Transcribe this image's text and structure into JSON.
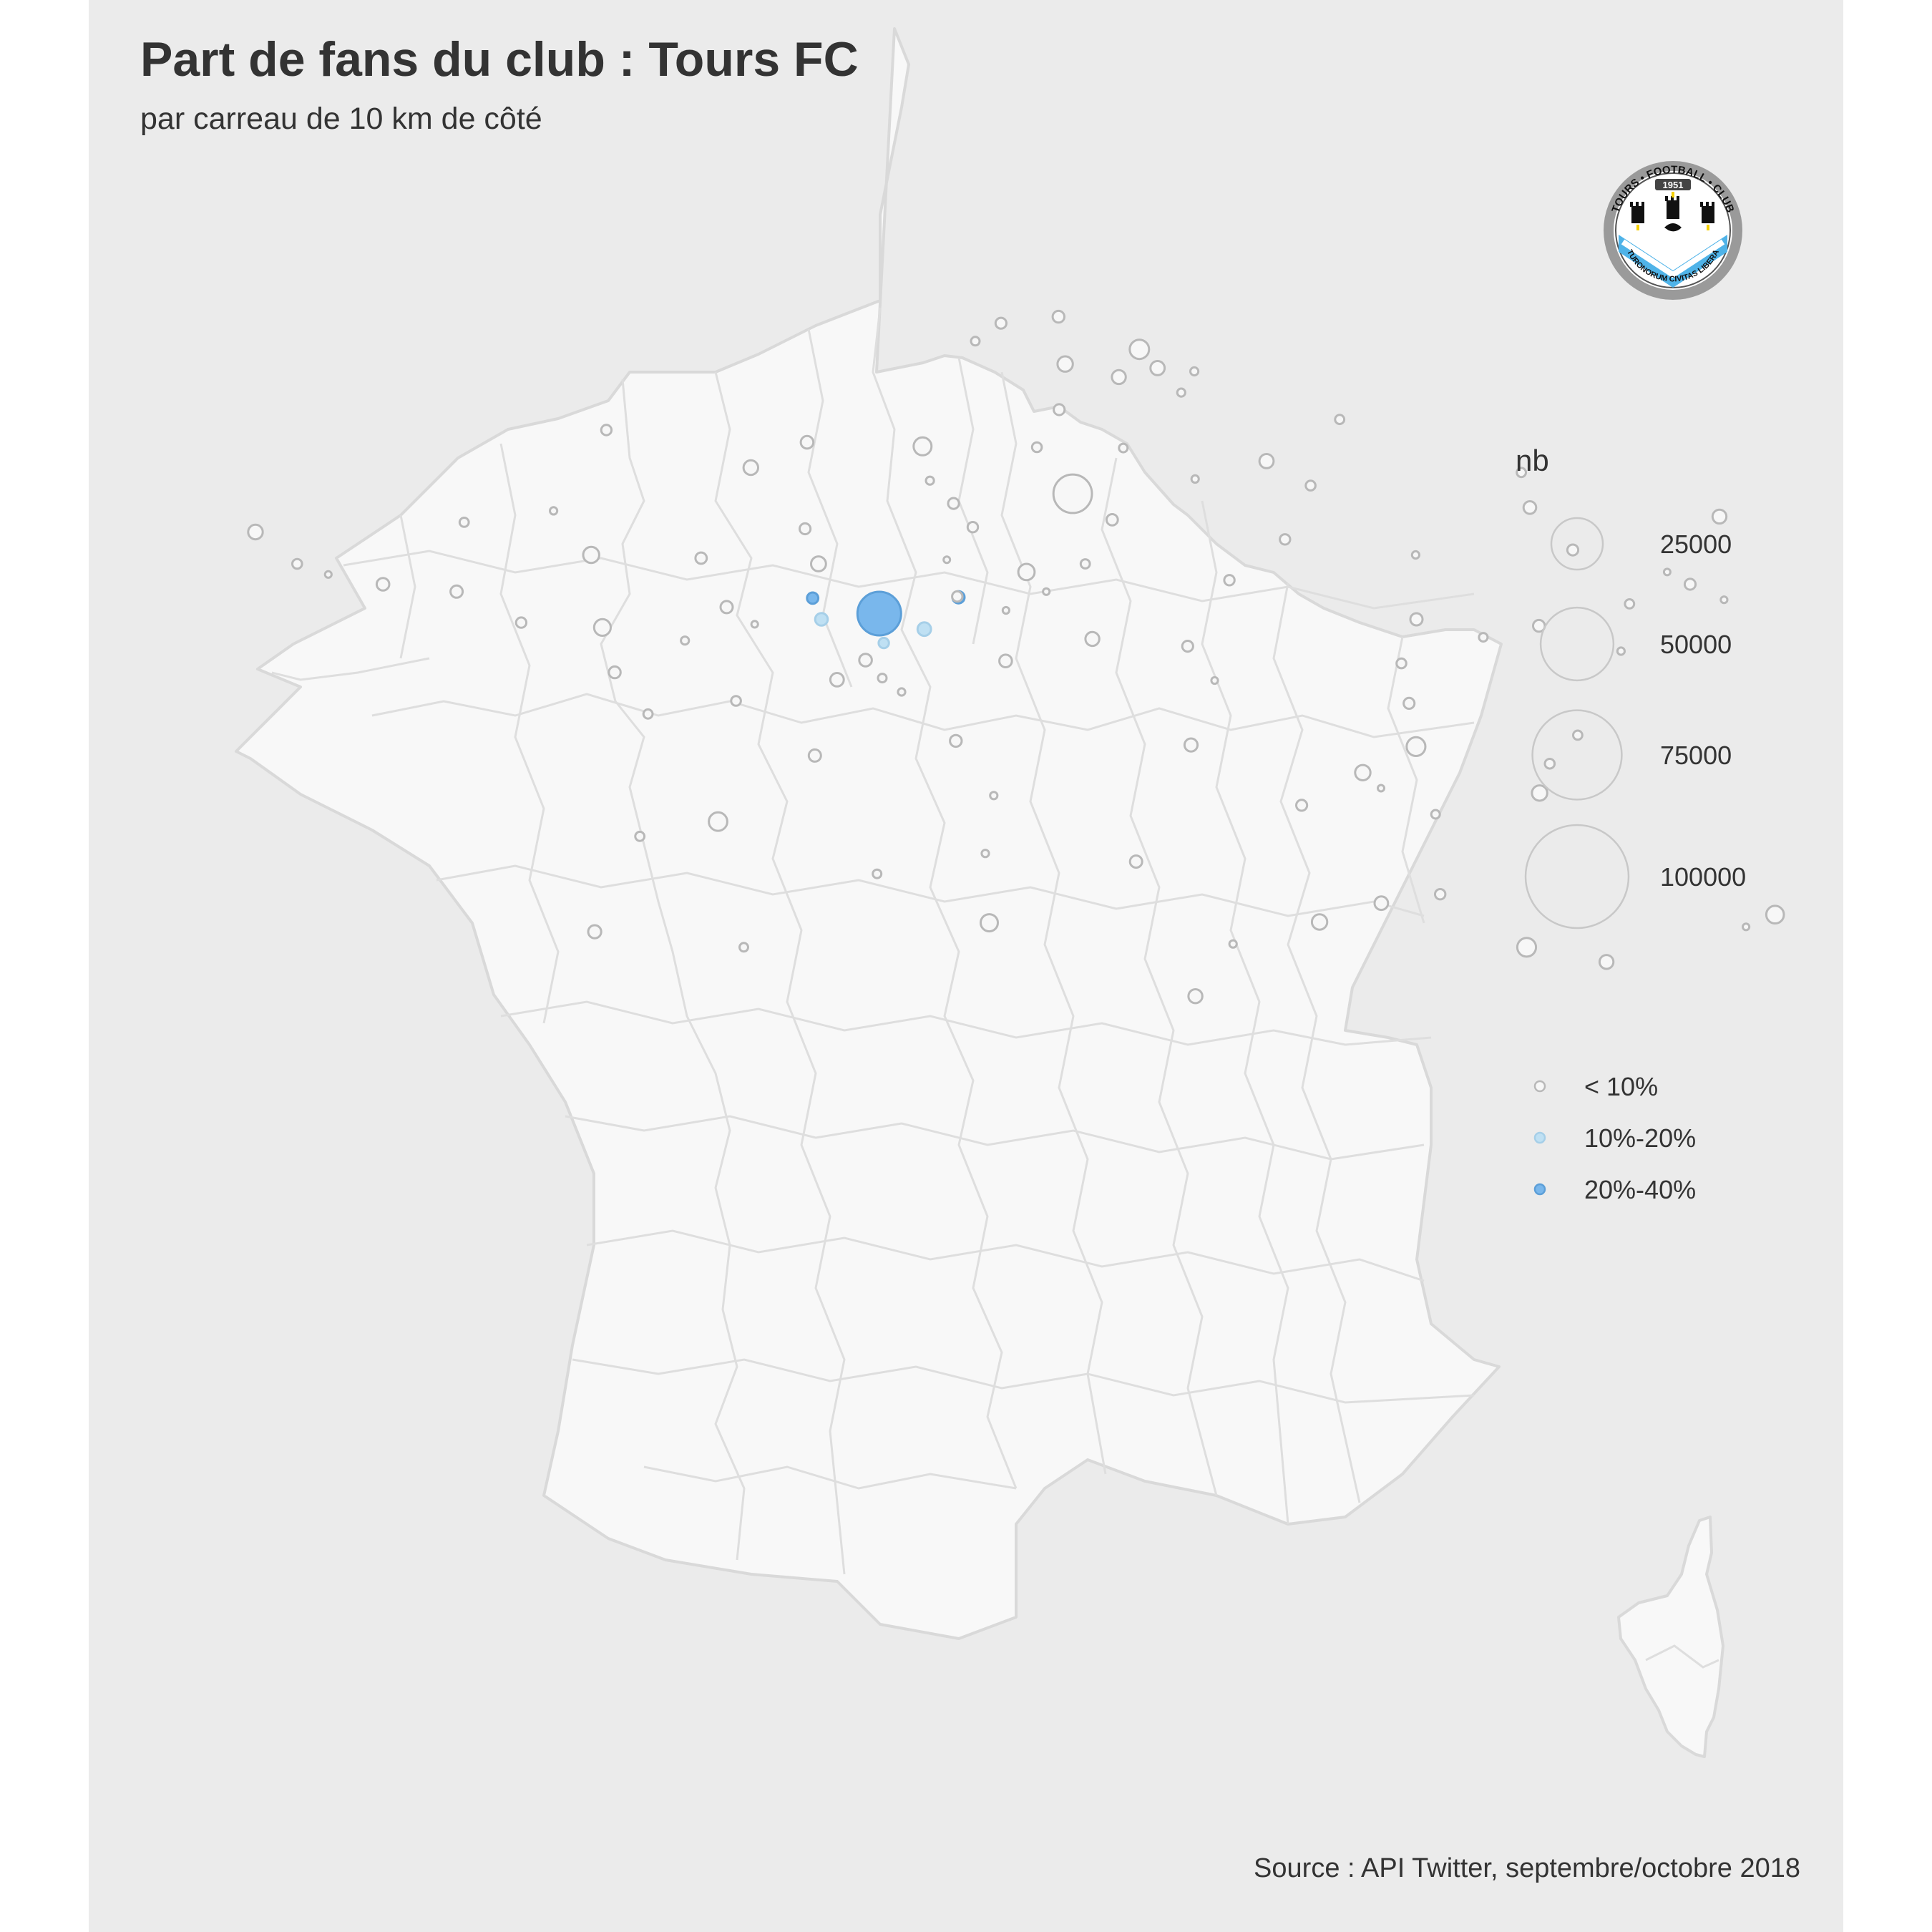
{
  "title": "Part de fans du club : Tours FC",
  "subtitle": "par carreau de 10 km de côté",
  "source": "Source : API Twitter, septembre/octobre 2018",
  "logo": {
    "top_text": "TOURS • FOOTBALL • CLUB",
    "year": "1951",
    "motto": "TURONORUM CIVITAS LIBERA",
    "colors": {
      "sky": "#4fb3e8",
      "ring": "#9a9a9a",
      "black": "#111111",
      "gold": "#f5d000"
    }
  },
  "legend": {
    "size_title": "nb",
    "size_entries": [
      {
        "label": "25000",
        "value": 25000
      },
      {
        "label": "50000",
        "value": 50000
      },
      {
        "label": "75000",
        "value": 75000
      },
      {
        "label": "100000",
        "value": 100000
      }
    ],
    "color_entries": [
      {
        "label": "< 10%",
        "fill": "#f7f7f7",
        "stroke": "#b8b8b8"
      },
      {
        "label": "10%-20%",
        "fill": "#bfe0f3",
        "stroke": "#a6cfe8"
      },
      {
        "label": "20%-40%",
        "fill": "#79b7ec",
        "stroke": "#5c9fd8"
      }
    ]
  },
  "colors": {
    "panel": "#ebebeb",
    "land": "#f8f8f8",
    "border": "#d9d9d9",
    "text": "#333333"
  },
  "chart_data": {
    "type": "scatter",
    "map": "France (départements)",
    "size_variable": "nb",
    "color_variable": "part de fans",
    "categories": [
      "< 10%",
      "10%-20%",
      "20%-40%"
    ],
    "points": [
      {
        "lon": 0.69,
        "lat": 47.39,
        "nb": 18000,
        "class": "20%-40%"
      },
      {
        "lon": 0.15,
        "lat": 47.58,
        "nb": 1200,
        "class": "20%-40%"
      },
      {
        "lon": 1.34,
        "lat": 47.59,
        "nb": 1400,
        "class": "20%-40%"
      },
      {
        "lon": 0.22,
        "lat": 47.32,
        "nb": 1500,
        "class": "10%-20%"
      },
      {
        "lon": 1.05,
        "lat": 47.2,
        "nb": 1700,
        "class": "10%-20%"
      },
      {
        "lon": 0.72,
        "lat": 47.03,
        "nb": 1000,
        "class": "10%-20%"
      },
      {
        "lon": 2.35,
        "lat": 48.86,
        "nb": 14000,
        "class": "< 10%"
      },
      {
        "lon": 3.06,
        "lat": 50.63,
        "nb": 3500,
        "class": "< 10%"
      },
      {
        "lon": 2.39,
        "lat": 50.45,
        "nb": 2200,
        "class": "< 10%"
      },
      {
        "lon": 2.85,
        "lat": 50.29,
        "nb": 1800,
        "class": "< 10%"
      },
      {
        "lon": 3.2,
        "lat": 50.4,
        "nb": 1900,
        "class": "< 10%"
      },
      {
        "lon": 1.85,
        "lat": 50.95,
        "nb": 1100,
        "class": "< 10%"
      },
      {
        "lon": 2.37,
        "lat": 51.03,
        "nb": 1300,
        "class": "< 10%"
      },
      {
        "lon": 1.61,
        "lat": 50.73,
        "nb": 700,
        "class": "< 10%"
      },
      {
        "lon": 3.38,
        "lat": 50.1,
        "nb": 600,
        "class": "< 10%"
      },
      {
        "lon": 3.52,
        "lat": 50.36,
        "nb": 600,
        "class": "< 10%"
      },
      {
        "lon": 2.3,
        "lat": 49.89,
        "nb": 1100,
        "class": "< 10%"
      },
      {
        "lon": 1.1,
        "lat": 49.44,
        "nb": 3000,
        "class": "< 10%"
      },
      {
        "lon": 0.11,
        "lat": 49.49,
        "nb": 1500,
        "class": "< 10%"
      },
      {
        "lon": -0.37,
        "lat": 49.18,
        "nb": 2000,
        "class": "< 10%"
      },
      {
        "lon": -1.62,
        "lat": 49.64,
        "nb": 1000,
        "class": "< 10%"
      },
      {
        "lon": 2.08,
        "lat": 49.43,
        "nb": 900,
        "class": "< 10%"
      },
      {
        "lon": 2.82,
        "lat": 49.42,
        "nb": 700,
        "class": "< 10%"
      },
      {
        "lon": 4.03,
        "lat": 49.26,
        "nb": 1900,
        "class": "< 10%"
      },
      {
        "lon": 3.4,
        "lat": 49.04,
        "nb": 500,
        "class": "< 10%"
      },
      {
        "lon": 4.72,
        "lat": 49.77,
        "nb": 800,
        "class": "< 10%"
      },
      {
        "lon": 1.15,
        "lat": 49.02,
        "nb": 600,
        "class": "< 10%"
      },
      {
        "lon": 6.18,
        "lat": 49.12,
        "nb": 800,
        "class": "< 10%"
      },
      {
        "lon": 7.75,
        "lat": 48.58,
        "nb": 1800,
        "class": "< 10%"
      },
      {
        "lon": 7.34,
        "lat": 47.75,
        "nb": 1100,
        "class": "< 10%"
      },
      {
        "lon": 6.18,
        "lat": 48.69,
        "nb": 1500,
        "class": "< 10%"
      },
      {
        "lon": 6.45,
        "lat": 48.17,
        "nb": 1100,
        "class": "< 10%"
      },
      {
        "lon": 7.58,
        "lat": 47.56,
        "nb": 400,
        "class": "< 10%"
      },
      {
        "lon": 7.18,
        "lat": 47.9,
        "nb": 300,
        "class": "< 10%"
      },
      {
        "lon": 4.37,
        "lat": 48.96,
        "nb": 900,
        "class": "< 10%"
      },
      {
        "lon": 4.08,
        "lat": 48.3,
        "nb": 1000,
        "class": "< 10%"
      },
      {
        "lon": 5.14,
        "lat": 48.11,
        "nb": 500,
        "class": "< 10%"
      },
      {
        "lon": 6.02,
        "lat": 47.24,
        "nb": 1300,
        "class": "< 10%"
      },
      {
        "lon": 6.8,
        "lat": 47.51,
        "nb": 800,
        "class": "< 10%"
      },
      {
        "lon": 5.04,
        "lat": 47.32,
        "nb": 1400,
        "class": "< 10%"
      },
      {
        "lon": 5.55,
        "lat": 47.1,
        "nb": 700,
        "class": "< 10%"
      },
      {
        "lon": 6.63,
        "lat": 46.93,
        "nb": 500,
        "class": "< 10%"
      },
      {
        "lon": 4.85,
        "lat": 46.78,
        "nb": 900,
        "class": "< 10%"
      },
      {
        "lon": 3.57,
        "lat": 47.8,
        "nb": 1000,
        "class": "< 10%"
      },
      {
        "lon": 3.16,
        "lat": 46.99,
        "nb": 1100,
        "class": "< 10%"
      },
      {
        "lon": 2.4,
        "lat": 48.0,
        "nb": 800,
        "class": "< 10%"
      },
      {
        "lon": 2.66,
        "lat": 48.54,
        "nb": 1200,
        "class": "< 10%"
      },
      {
        "lon": 1.91,
        "lat": 47.9,
        "nb": 2500,
        "class": "< 10%"
      },
      {
        "lon": 1.49,
        "lat": 48.45,
        "nb": 1000,
        "class": "< 10%"
      },
      {
        "lon": 2.06,
        "lat": 47.66,
        "nb": 400,
        "class": "< 10%"
      },
      {
        "lon": 1.33,
        "lat": 47.6,
        "nb": 1000,
        "class": "< 10%"
      },
      {
        "lon": 1.34,
        "lat": 48.74,
        "nb": 1100,
        "class": "< 10%"
      },
      {
        "lon": 1.26,
        "lat": 48.05,
        "nb": 300,
        "class": "< 10%"
      },
      {
        "lon": 2.4,
        "lat": 47.08,
        "nb": 1800,
        "class": "< 10%"
      },
      {
        "lon": 1.69,
        "lat": 46.81,
        "nb": 1500,
        "class": "< 10%"
      },
      {
        "lon": 1.72,
        "lat": 47.43,
        "nb": 400,
        "class": "< 10%"
      },
      {
        "lon": 0.2,
        "lat": 48.0,
        "nb": 2100,
        "class": "< 10%"
      },
      {
        "lon": 0.09,
        "lat": 48.43,
        "nb": 1100,
        "class": "< 10%"
      },
      {
        "lon": -0.55,
        "lat": 47.47,
        "nb": 1400,
        "class": "< 10%"
      },
      {
        "lon": -0.77,
        "lat": 48.07,
        "nb": 1200,
        "class": "< 10%"
      },
      {
        "lon": -1.68,
        "lat": 48.11,
        "nb": 2400,
        "class": "< 10%"
      },
      {
        "lon": -2.76,
        "lat": 48.51,
        "nb": 800,
        "class": "< 10%"
      },
      {
        "lon": -2.76,
        "lat": 47.66,
        "nb": 1400,
        "class": "< 10%"
      },
      {
        "lon": -3.37,
        "lat": 47.75,
        "nb": 1500,
        "class": "< 10%"
      },
      {
        "lon": -4.49,
        "lat": 48.39,
        "nb": 2000,
        "class": "< 10%"
      },
      {
        "lon": -4.1,
        "lat": 48.0,
        "nb": 900,
        "class": "< 10%"
      },
      {
        "lon": -3.83,
        "lat": 47.87,
        "nb": 400,
        "class": "< 10%"
      },
      {
        "lon": -2.02,
        "lat": 48.65,
        "nb": 500,
        "class": "< 10%"
      },
      {
        "lon": -1.55,
        "lat": 47.22,
        "nb": 2600,
        "class": "< 10%"
      },
      {
        "lon": -2.21,
        "lat": 47.28,
        "nb": 1000,
        "class": "< 10%"
      },
      {
        "lon": -0.88,
        "lat": 47.06,
        "nb": 600,
        "class": "< 10%"
      },
      {
        "lon": -1.43,
        "lat": 46.67,
        "nb": 1300,
        "class": "< 10%"
      },
      {
        "lon": -0.46,
        "lat": 46.32,
        "nb": 900,
        "class": "< 10%"
      },
      {
        "lon": -0.32,
        "lat": 47.26,
        "nb": 400,
        "class": "< 10%"
      },
      {
        "lon": 0.34,
        "lat": 46.58,
        "nb": 1700,
        "class": "< 10%"
      },
      {
        "lon": 0.57,
        "lat": 46.82,
        "nb": 1500,
        "class": "< 10%"
      },
      {
        "lon": 0.7,
        "lat": 46.6,
        "nb": 700,
        "class": "< 10%"
      },
      {
        "lon": 0.85,
        "lat": 46.43,
        "nb": 500,
        "class": "< 10%"
      },
      {
        "lon": -1.15,
        "lat": 46.16,
        "nb": 800,
        "class": "< 10%"
      },
      {
        "lon": 0.16,
        "lat": 45.65,
        "nb": 1400,
        "class": "< 10%"
      },
      {
        "lon": 1.26,
        "lat": 45.83,
        "nb": 1300,
        "class": "< 10%"
      },
      {
        "lon": 3.09,
        "lat": 45.78,
        "nb": 1600,
        "class": "< 10%"
      },
      {
        "lon": 3.34,
        "lat": 46.57,
        "nb": 400,
        "class": "< 10%"
      },
      {
        "lon": 4.85,
        "lat": 46.29,
        "nb": 1100,
        "class": "< 10%"
      },
      {
        "lon": 4.84,
        "lat": 45.76,
        "nb": 3300,
        "class": "< 10%"
      },
      {
        "lon": 5.85,
        "lat": 45.55,
        "nb": 900,
        "class": "< 10%"
      },
      {
        "lon": 6.12,
        "lat": 45.9,
        "nb": 800,
        "class": "< 10%"
      },
      {
        "lon": 4.39,
        "lat": 45.44,
        "nb": 2200,
        "class": "< 10%"
      },
      {
        "lon": 4.51,
        "lat": 45.25,
        "nb": 300,
        "class": "< 10%"
      },
      {
        "lon": 5.72,
        "lat": 45.19,
        "nb": 2200,
        "class": "< 10%"
      },
      {
        "lon": 4.89,
        "lat": 44.93,
        "nb": 700,
        "class": "< 10%"
      },
      {
        "lon": 3.88,
        "lat": 45.04,
        "nb": 1100,
        "class": "< 10%"
      },
      {
        "lon": 1.53,
        "lat": 45.16,
        "nb": 500,
        "class": "< 10%"
      },
      {
        "lon": -0.58,
        "lat": 44.84,
        "nb": 3200,
        "class": "< 10%"
      },
      {
        "lon": -1.17,
        "lat": 44.66,
        "nb": 800,
        "class": "< 10%"
      },
      {
        "lon": 0.62,
        "lat": 44.2,
        "nb": 700,
        "class": "< 10%"
      },
      {
        "lon": 1.44,
        "lat": 44.45,
        "nb": 500,
        "class": "< 10%"
      },
      {
        "lon": 2.57,
        "lat": 44.35,
        "nb": 1400,
        "class": "< 10%"
      },
      {
        "lon": 1.44,
        "lat": 43.6,
        "nb": 2800,
        "class": "< 10%"
      },
      {
        "lon": 3.88,
        "lat": 43.61,
        "nb": 2200,
        "class": "< 10%"
      },
      {
        "lon": 4.36,
        "lat": 43.84,
        "nb": 1700,
        "class": "< 10%"
      },
      {
        "lon": 4.81,
        "lat": 43.95,
        "nb": 1000,
        "class": "< 10%"
      },
      {
        "lon": 5.37,
        "lat": 43.3,
        "nb": 3300,
        "class": "< 10%"
      },
      {
        "lon": 5.93,
        "lat": 43.12,
        "nb": 1800,
        "class": "< 10%"
      },
      {
        "lon": 7.26,
        "lat": 43.7,
        "nb": 2900,
        "class": "< 10%"
      },
      {
        "lon": 7.02,
        "lat": 43.55,
        "nb": 400,
        "class": "< 10%"
      },
      {
        "lon": -1.47,
        "lat": 43.49,
        "nb": 1600,
        "class": "< 10%"
      },
      {
        "lon": -0.37,
        "lat": 43.3,
        "nb": 700,
        "class": "< 10%"
      },
      {
        "lon": 2.9,
        "lat": 42.7,
        "nb": 1800,
        "class": "< 10%"
      },
      {
        "lon": 3.22,
        "lat": 43.34,
        "nb": 500,
        "class": "< 10%"
      },
      {
        "lon": 8.74,
        "lat": 41.93,
        "nb": 1000,
        "class": "< 10%"
      },
      {
        "lon": 9.45,
        "lat": 42.7,
        "nb": 900,
        "class": "< 10%"
      }
    ]
  }
}
